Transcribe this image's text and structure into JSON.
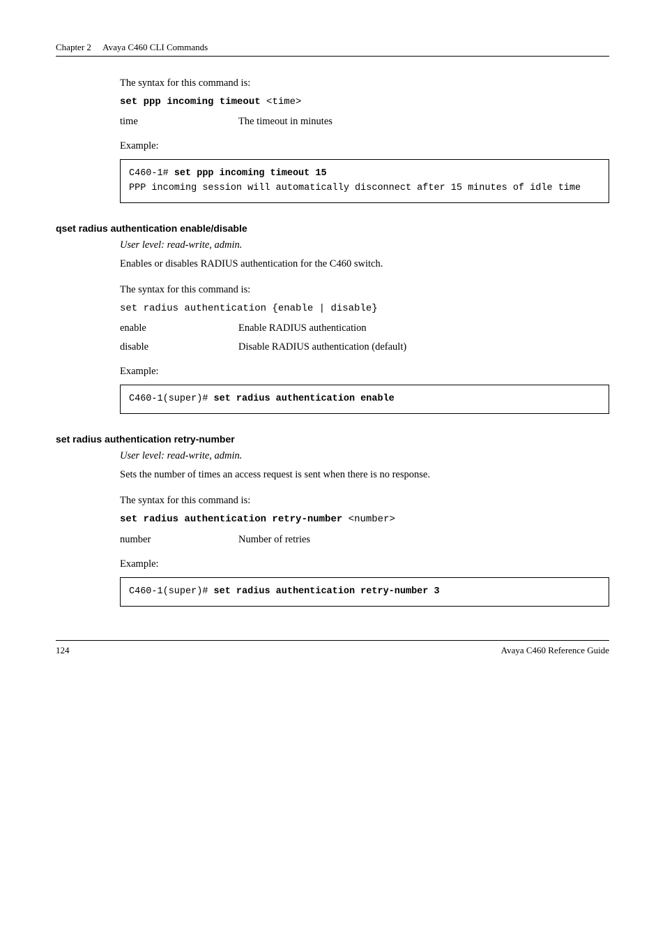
{
  "header": {
    "chapter": "Chapter 2",
    "title": "Avaya C460 CLI Commands"
  },
  "block1": {
    "syntax_intro": "The syntax for this command is:",
    "cmd_bold": "set ppp incoming timeout",
    "cmd_arg": " <time>",
    "param_key": "time",
    "param_val": "The timeout in minutes",
    "example_label": "Example:",
    "code": "C460-1# set ppp incoming timeout 15\nPPP incoming session will automatically disconnect after 15 minutes of idle time",
    "code_line1_prefix": "C460-1# ",
    "code_line1_bold": "set ppp incoming timeout 15",
    "code_rest": "PPP incoming session will automatically disconnect after 15 minutes of idle time"
  },
  "section2": {
    "heading": "qset radius authentication enable/disable",
    "userlevel": "User level: read-write, admin.",
    "desc": "Enables or disables RADIUS authentication for the C460 switch.",
    "syntax_intro": "The syntax for this command is:",
    "cmd": "set radius authentication {enable | disable}",
    "p1_key": "enable",
    "p1_val": "Enable RADIUS authentication",
    "p2_key": "disable",
    "p2_val": "Disable RADIUS authentication (default)",
    "example_label": "Example:",
    "code_prefix": "C460-1(super)# ",
    "code_bold": "set radius authentication enable"
  },
  "section3": {
    "heading": "set radius authentication retry-number",
    "userlevel": "User level: read-write, admin.",
    "desc": "Sets the number of times an access request is sent when there is no response.",
    "syntax_intro": "The syntax for this command is:",
    "cmd_bold": "set radius authentication retry-number",
    "cmd_arg": " <number>",
    "param_key": "number",
    "param_val": "Number of retries",
    "example_label": "Example:",
    "code_prefix": "C460-1(super)# ",
    "code_bold": "set radius authentication retry-number 3"
  },
  "footer": {
    "page": "124",
    "right": "Avaya C460 Reference Guide"
  }
}
